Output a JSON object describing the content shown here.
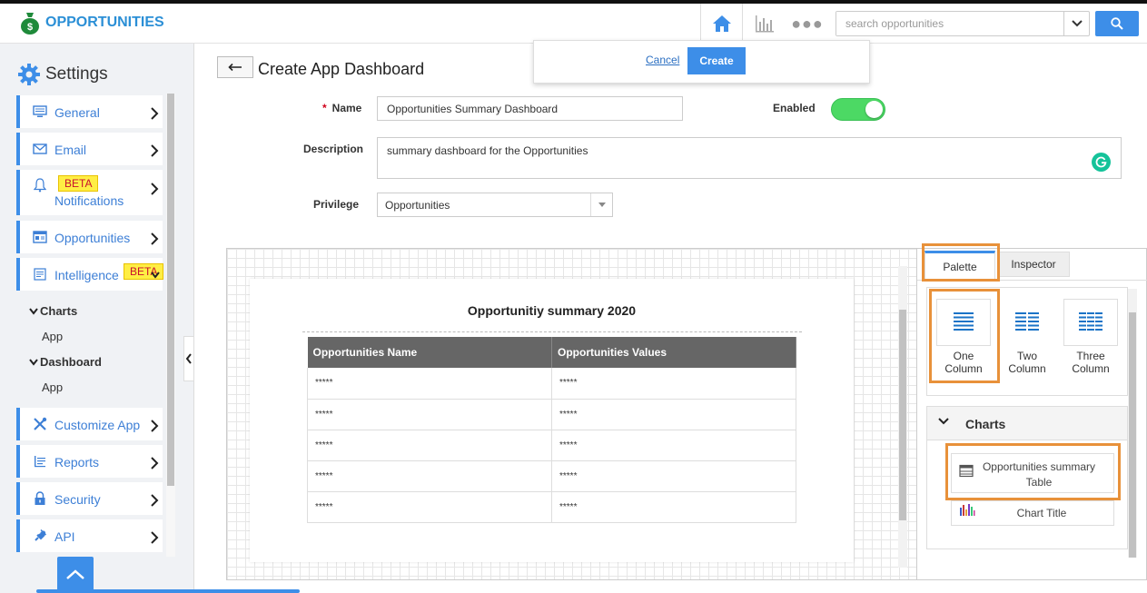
{
  "app": {
    "title": "OPPORTUNITIES"
  },
  "search": {
    "placeholder": "search opportunities"
  },
  "create_popup": {
    "cancel_label": "Cancel",
    "create_label": "Create"
  },
  "sidebar": {
    "title": "Settings",
    "items": [
      {
        "label": "General",
        "icon": "monitor-icon"
      },
      {
        "label": "Email",
        "icon": "envelope-icon"
      },
      {
        "label": "Notifications",
        "icon": "bell-icon",
        "badge": "BETA"
      },
      {
        "label": "Opportunities",
        "icon": "list-card-icon"
      },
      {
        "label": "Intelligence",
        "icon": "document-icon",
        "badge": "BETA"
      },
      {
        "label": "Customize App",
        "icon": "tools-icon"
      },
      {
        "label": "Reports",
        "icon": "report-icon"
      },
      {
        "label": "Security",
        "icon": "lock-icon"
      },
      {
        "label": "API",
        "icon": "plug-icon"
      }
    ],
    "sub_sections": [
      {
        "header": "Charts",
        "item": "App"
      },
      {
        "header": "Dashboard",
        "item": "App"
      }
    ]
  },
  "page": {
    "title": "Create App Dashboard"
  },
  "form": {
    "name_label": "Name",
    "name_value": "Opportunities Summary Dashboard",
    "enabled_label": "Enabled",
    "enabled": true,
    "description_label": "Description",
    "description_value": "summary dashboard for the Opportunities",
    "privilege_label": "Privilege",
    "privilege_value": "Opportunities"
  },
  "dashboard": {
    "title": "Opportunitiy summary 2020",
    "columns": [
      "Opportunities Name",
      "Opportunities Values"
    ],
    "rows": [
      [
        "*****",
        "*****"
      ],
      [
        "*****",
        "*****"
      ],
      [
        "*****",
        "*****"
      ],
      [
        "*****",
        "*****"
      ],
      [
        "*****",
        "*****"
      ]
    ]
  },
  "panel": {
    "tabs": [
      "Palette",
      "Inspector"
    ],
    "active_tab": "Palette",
    "layouts": [
      {
        "line1": "One",
        "line2": "Column"
      },
      {
        "line1": "Two",
        "line2": "Column"
      },
      {
        "line1": "Three",
        "line2": "Column"
      }
    ],
    "charts_header": "Charts",
    "chart_items": [
      {
        "label": "Opportunities summary Table"
      },
      {
        "label": "Chart Title"
      }
    ]
  },
  "colors": {
    "accent": "#3d8ee8",
    "brand": "#2b8fd6",
    "toggle_on": "#4cd964",
    "highlight": "#e8913a",
    "beta_bg": "#ffee44",
    "beta_text": "#c8102e",
    "table_header": "#666666"
  }
}
